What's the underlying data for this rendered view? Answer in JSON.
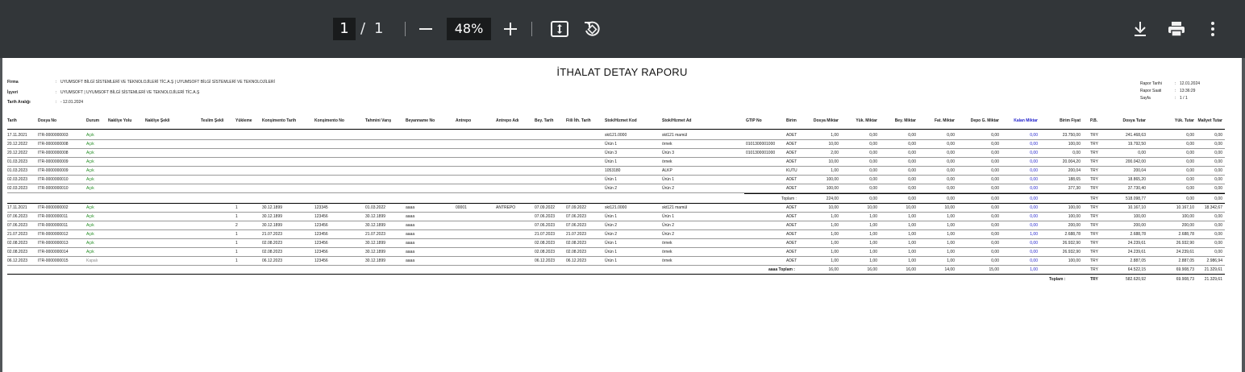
{
  "toolbar": {
    "current_page": "1",
    "separator": "/",
    "total_pages": "1",
    "zoom": "48%"
  },
  "report": {
    "title": "İTHALAT DETAY RAPORU",
    "meta_left": [
      {
        "label": "Firma",
        "value": "UYUMSOFT BİLGİ SİSTEMLERİ VE TEKNOLOJİLERİ TİC.A.Ş | UYUMSOFT BİLGİ SİSTEMLERİ VE TEKNOLOJİLERİ"
      },
      {
        "label": "İşyeri",
        "value": "UYUMSOFT | UYUMSOFT BİLGİ SİSTEMLERİ VE TEKNOLOJİLERİ TİC.A.Ş"
      },
      {
        "label": "Tarih Aralığı",
        "value": "- 12.01.2024"
      }
    ],
    "meta_right": [
      {
        "label": "Rapor Tarihi",
        "value": "12.01.2024"
      },
      {
        "label": "Rapor Saati",
        "value": "13:36:29"
      },
      {
        "label": "Sayfa",
        "value": "1 / 1"
      }
    ],
    "columns": [
      "Tarih",
      "Dosya No",
      "Durum",
      "Nakliye Yolu",
      "Nakliye Şekli",
      "Teslim Şekli",
      "Yükleme",
      "Konşimento Tarih",
      "Konşimento No",
      "Tahmini Varış",
      "Beyanname No",
      "Antrepo",
      "Antrepo Adı",
      "Bey. Tarih",
      "Fiili İth. Tarih",
      "Stok/Hizmet Kod",
      "Stok/Hizmet Ad",
      "GTIP No",
      "Birim",
      "Dosya Miktar",
      "Yük. Miktar",
      "Bey. Miktar",
      "Fat. Miktar",
      "Depo G. Miktar",
      "Kalan Miktar",
      "Birim Fiyat",
      "P.B.",
      "Dosya Tutar",
      "Yük. Tutar",
      "Maliyet Tutar"
    ],
    "group1_rows": [
      [
        "17.11.2021",
        "ITR-0000000003",
        "Açık",
        "",
        "",
        "",
        "",
        "",
        "",
        "",
        "",
        "",
        "",
        "",
        "",
        "skt121.0000",
        "skt121 mamül",
        "",
        "ADET",
        "1,00",
        "0,00",
        "0,00",
        "0,00",
        "0,00",
        "0,00",
        "23.750,00",
        "TRY",
        "241.468,63",
        "0,00",
        "0,00"
      ],
      [
        "20.12.2022",
        "ITR-0000000008",
        "Açık",
        "",
        "",
        "",
        "",
        "",
        "",
        "",
        "",
        "",
        "",
        "",
        "",
        "Ürün 1",
        "örnek",
        "0101300001000",
        "ADET",
        "10,00",
        "0,00",
        "0,00",
        "0,00",
        "0,00",
        "0,00",
        "100,00",
        "TRY",
        "19.792,50",
        "0,00",
        "0,00"
      ],
      [
        "20.12.2022",
        "ITR-0000000008",
        "Açık",
        "",
        "",
        "",
        "",
        "",
        "",
        "",
        "",
        "",
        "",
        "",
        "",
        "Ürün 3",
        "Ürün 3",
        "0101300001000",
        "ADET",
        "2,00",
        "0,00",
        "0,00",
        "0,00",
        "0,00",
        "0,00",
        "0,00",
        "TRY",
        "0,00",
        "0,00",
        "0,00"
      ],
      [
        "01.03.2023",
        "ITR-0000000009",
        "Açık",
        "",
        "",
        "",
        "",
        "",
        "",
        "",
        "",
        "",
        "",
        "",
        "",
        "Ürün 1",
        "örnek",
        "",
        "ADET",
        "10,00",
        "0,00",
        "0,00",
        "0,00",
        "0,00",
        "0,00",
        "20.004,20",
        "TRY",
        "200.042,00",
        "0,00",
        "0,00"
      ],
      [
        "01.03.2023",
        "ITR-0000000009",
        "Açık",
        "",
        "",
        "",
        "",
        "",
        "",
        "",
        "",
        "",
        "",
        "",
        "",
        "1053180",
        "ALKP",
        "",
        "KUTU",
        "1,00",
        "0,00",
        "0,00",
        "0,00",
        "0,00",
        "0,00",
        "200,04",
        "TRY",
        "200,04",
        "0,00",
        "0,00"
      ],
      [
        "02.03.2023",
        "ITR-0000000010",
        "Açık",
        "",
        "",
        "",
        "",
        "",
        "",
        "",
        "",
        "",
        "",
        "",
        "",
        "Ürün 1",
        "Ürün 1",
        "",
        "ADET",
        "100,00",
        "0,00",
        "0,00",
        "0,00",
        "0,00",
        "0,00",
        "188,65",
        "TRY",
        "18.865,20",
        "0,00",
        "0,00"
      ],
      [
        "02.03.2023",
        "ITR-0000000010",
        "Açık",
        "",
        "",
        "",
        "",
        "",
        "",
        "",
        "",
        "",
        "",
        "",
        "",
        "Ürün 2",
        "Ürün 2",
        "",
        "ADET",
        "100,00",
        "0,00",
        "0,00",
        "0,00",
        "0,00",
        "0,00",
        "377,30",
        "TRY",
        "37.730,40",
        "0,00",
        "0,00"
      ]
    ],
    "group1_total": {
      "label": "Toplam :",
      "values": [
        "224,00",
        "0,00",
        "0,00",
        "0,00",
        "0,00",
        "0,00",
        "",
        "TRY",
        "518.098,77",
        "0,00",
        "0,00"
      ]
    },
    "group2_rows": [
      [
        "17.11.2021",
        "ITR-0000000002",
        "Açık",
        "",
        "",
        "",
        "1",
        "30.12.1899",
        "123345",
        "01.03.2022",
        "aaaa",
        "00001",
        "ANTREPO",
        "07.09.2022",
        "07.09.2022",
        "skt121.0000",
        "skt121 mamül",
        "",
        "ADET",
        "10,00",
        "10,00",
        "10,00",
        "10,00",
        "0,00",
        "0,00",
        "100,00",
        "TRY",
        "10.167,10",
        "10.167,10",
        "18.342,67"
      ],
      [
        "07.06.2023",
        "ITR-0000000011",
        "Açık",
        "",
        "",
        "",
        "1",
        "30.12.1899",
        "123456",
        "30.12.1899",
        "aaaa",
        "",
        "",
        "07.06.2023",
        "07.06.2023",
        "Ürün 1",
        "Ürün 1",
        "",
        "ADET",
        "1,00",
        "1,00",
        "1,00",
        "1,00",
        "0,00",
        "0,00",
        "100,00",
        "TRY",
        "100,00",
        "100,00",
        "0,00"
      ],
      [
        "07.06.2023",
        "ITR-0000000011",
        "Açık",
        "",
        "",
        "",
        "2",
        "30.12.1899",
        "123456",
        "30.12.1899",
        "aaaa",
        "",
        "",
        "07.06.2023",
        "07.06.2023",
        "Ürün 2",
        "Ürün 2",
        "",
        "ADET",
        "1,00",
        "1,00",
        "1,00",
        "1,00",
        "0,00",
        "0,00",
        "200,00",
        "TRY",
        "200,00",
        "200,00",
        "0,00"
      ],
      [
        "21.07.2023",
        "ITR-0000000012",
        "Açık",
        "",
        "",
        "",
        "1",
        "21.07.2023",
        "123456",
        "21.07.2023",
        "aaaa",
        "",
        "",
        "21.07.2023",
        "21.07.2023",
        "Ürün 2",
        "Ürün 2",
        "",
        "ADET",
        "1,00",
        "1,00",
        "1,00",
        "1,00",
        "0,00",
        "1,00",
        "2.688,78",
        "TRY",
        "2.688,78",
        "2.688,78",
        "0,00"
      ],
      [
        "02.08.2023",
        "ITR-0000000013",
        "Açık",
        "",
        "",
        "",
        "1",
        "02.08.2023",
        "123456",
        "30.12.1899",
        "aaaa",
        "",
        "",
        "02.08.2023",
        "02.08.2023",
        "Ürün 1",
        "örnek",
        "",
        "ADET",
        "1,00",
        "1,00",
        "1,00",
        "1,00",
        "0,00",
        "0,00",
        "26.932,90",
        "TRY",
        "24.239,61",
        "26.932,90",
        "0,00"
      ],
      [
        "02.08.2023",
        "ITR-0000000014",
        "Açık",
        "",
        "",
        "",
        "1",
        "02.08.2023",
        "123456",
        "30.12.1899",
        "aaaa",
        "",
        "",
        "02.08.2023",
        "02.08.2023",
        "Ürün 1",
        "örnek",
        "",
        "ADET",
        "1,00",
        "1,00",
        "1,00",
        "1,00",
        "0,00",
        "0,00",
        "26.932,90",
        "TRY",
        "24.239,61",
        "24.239,61",
        "0,00"
      ],
      [
        "06.12.2023",
        "ITR-0000000015",
        "Kapalı",
        "",
        "",
        "",
        "1",
        "06.12.2023",
        "123456",
        "30.12.1899",
        "aaaa",
        "",
        "",
        "06.12.2023",
        "06.12.2023",
        "Ürün 1",
        "örnek",
        "",
        "ADET",
        "1,00",
        "1,00",
        "1,00",
        "1,00",
        "0,00",
        "0,00",
        "100,00",
        "TRY",
        "2.887,05",
        "2.887,05",
        "2.986,94"
      ]
    ],
    "group2_total": {
      "label": "aaaa Toplam :",
      "values": [
        "16,00",
        "16,00",
        "16,00",
        "14,00",
        "15,00",
        "1,00",
        "",
        "TRY",
        "64.522,15",
        "69.908,73",
        "21.329,61"
      ]
    },
    "grand_total": {
      "label": "Toplam :",
      "currency": "TRY",
      "values": [
        "582.620,92",
        "69.908,73",
        "21.329,61"
      ]
    }
  },
  "colors": {
    "toolbar_bg": "#323639",
    "viewer_bg": "#525659",
    "status_open": "#1f8a1f",
    "kalan_header": "#2222cc"
  }
}
